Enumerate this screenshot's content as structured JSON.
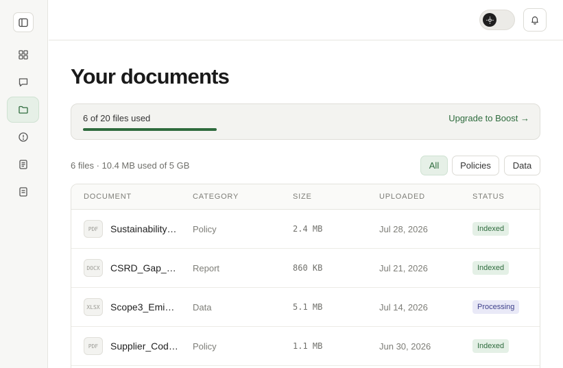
{
  "page": {
    "title": "Your documents"
  },
  "usage": {
    "text": "6 of 20 files used",
    "fraction": 0.3,
    "upgrade_label": "Upgrade to Boost →"
  },
  "summary": "6 files · 10.4 MB used of 5 GB",
  "filters": [
    {
      "label": "All",
      "active": true
    },
    {
      "label": "Policies",
      "active": false
    },
    {
      "label": "Data",
      "active": false
    }
  ],
  "table": {
    "columns": [
      "DOCUMENT",
      "CATEGORY",
      "SIZE",
      "UPLOADED",
      "STATUS"
    ],
    "rows": [
      {
        "type": "PDF",
        "name": "Sustainability…",
        "category": "Policy",
        "size": "2.4 MB",
        "uploaded": "Jul 28, 2026",
        "status": "Indexed"
      },
      {
        "type": "DOCX",
        "name": "CSRD_Gap_A…",
        "category": "Report",
        "size": "860 KB",
        "uploaded": "Jul 21, 2026",
        "status": "Indexed"
      },
      {
        "type": "XLSX",
        "name": "Scope3_Emis…",
        "category": "Data",
        "size": "5.1 MB",
        "uploaded": "Jul 14, 2026",
        "status": "Processing"
      },
      {
        "type": "PDF",
        "name": "Supplier_Cod…",
        "category": "Policy",
        "size": "1.1 MB",
        "uploaded": "Jun 30, 2026",
        "status": "Indexed"
      }
    ]
  },
  "sidebar": {
    "items": [
      {
        "icon": "grid-icon"
      },
      {
        "icon": "chat-icon"
      },
      {
        "icon": "folder-icon",
        "active": true
      },
      {
        "icon": "alert-icon"
      },
      {
        "icon": "document-icon"
      },
      {
        "icon": "report-icon"
      }
    ]
  },
  "colors": {
    "accent": "#2e6b3d",
    "processing": "#3d3f8a"
  }
}
